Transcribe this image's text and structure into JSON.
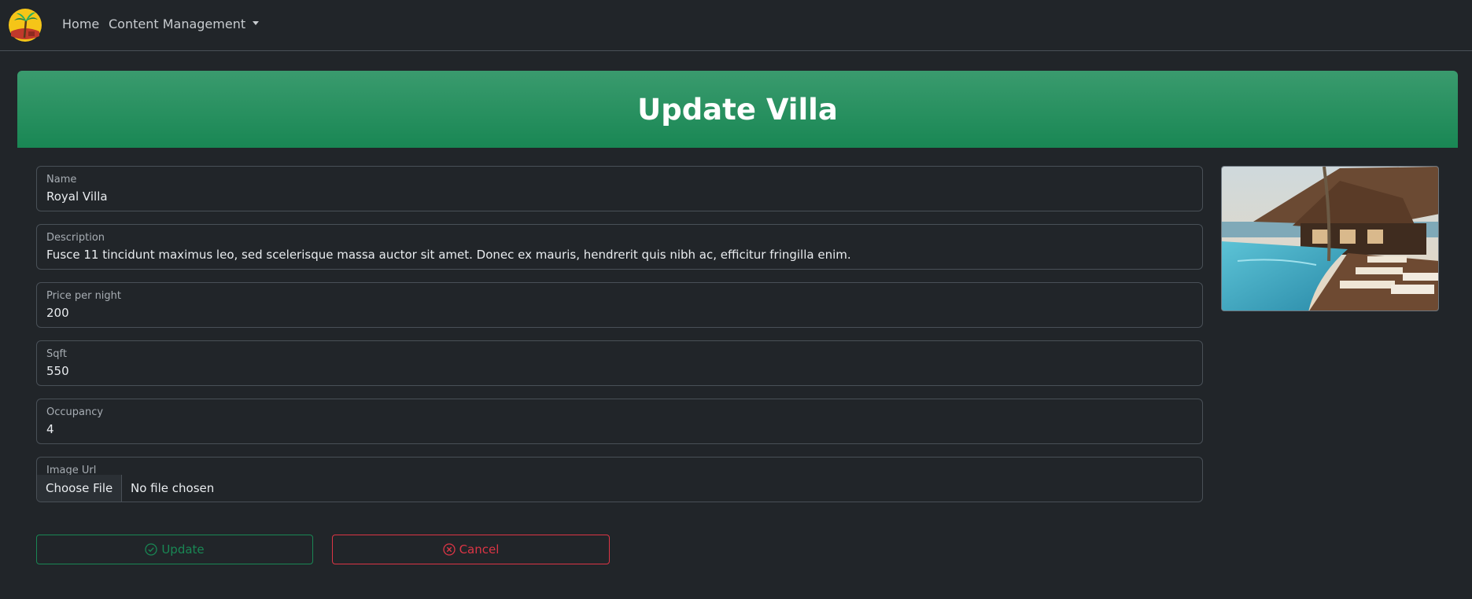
{
  "nav": {
    "home_label": "Home",
    "content_label": "Content Management"
  },
  "header": {
    "title": "Update Villa"
  },
  "form": {
    "name": {
      "label": "Name",
      "value": "Royal Villa"
    },
    "description": {
      "label": "Description",
      "value": "Fusce 11 tincidunt maximus leo, sed scelerisque massa auctor sit amet. Donec ex mauris, hendrerit quis nibh ac, efficitur fringilla enim."
    },
    "price": {
      "label": "Price per night",
      "value": "200"
    },
    "sqft": {
      "label": "Sqft",
      "value": "550"
    },
    "occupancy": {
      "label": "Occupancy",
      "value": "4"
    },
    "image": {
      "label": "Image Url",
      "button": "Choose File",
      "status": "No file chosen"
    }
  },
  "actions": {
    "update_label": "Update",
    "cancel_label": "Cancel"
  },
  "colors": {
    "success": "#198754",
    "danger": "#dc3545",
    "background": "#212529"
  }
}
